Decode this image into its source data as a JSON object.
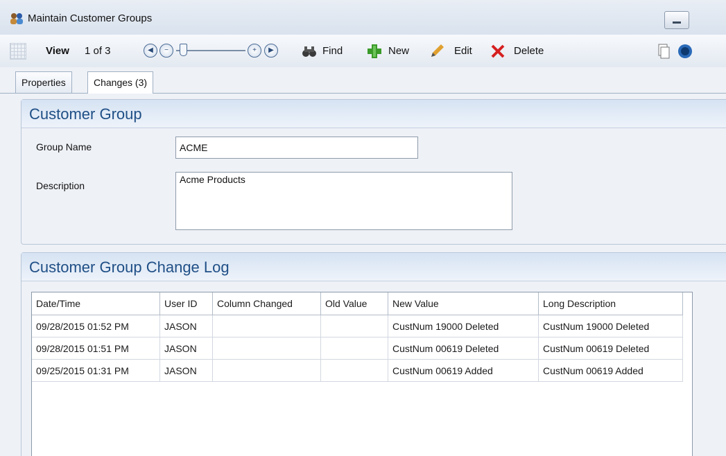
{
  "window": {
    "title": "Maintain Customer Groups"
  },
  "toolbar": {
    "view_label": "View",
    "record_position": "1 of 3",
    "find_label": "Find",
    "new_label": "New",
    "edit_label": "Edit",
    "delete_label": "Delete"
  },
  "tabs": [
    {
      "label": "Properties"
    },
    {
      "label": "Changes (3)"
    }
  ],
  "customer_group": {
    "title": "Customer Group",
    "group_name_label": "Group Name",
    "group_name_value": "ACME",
    "description_label": "Description",
    "description_value": "Acme Products"
  },
  "change_log": {
    "title": "Customer Group Change Log",
    "columns": [
      "Date/Time",
      "User ID",
      "Column Changed",
      "Old Value",
      "New Value",
      "Long Description"
    ],
    "rows": [
      [
        "09/28/2015 01:52 PM",
        "JASON",
        "",
        "",
        "CustNum 19000 Deleted",
        "CustNum 19000 Deleted"
      ],
      [
        "09/28/2015 01:51 PM",
        "JASON",
        "",
        "",
        "CustNum 00619 Deleted",
        "CustNum 00619 Deleted"
      ],
      [
        "09/25/2015 01:31 PM",
        "JASON",
        "",
        "",
        "CustNum 00619 Added",
        "CustNum 00619 Added"
      ]
    ]
  },
  "colors": {
    "header_text": "#1f4f86",
    "delete_red": "#d62020",
    "new_green": "#3a9a2a"
  },
  "icons": [
    "app-users-icon",
    "grid-icon",
    "first-record-icon",
    "zoom-out-icon",
    "zoom-in-icon",
    "last-record-icon",
    "binoculars-icon",
    "plus-icon",
    "pencil-icon",
    "x-icon",
    "copy-icon",
    "help-icon"
  ]
}
